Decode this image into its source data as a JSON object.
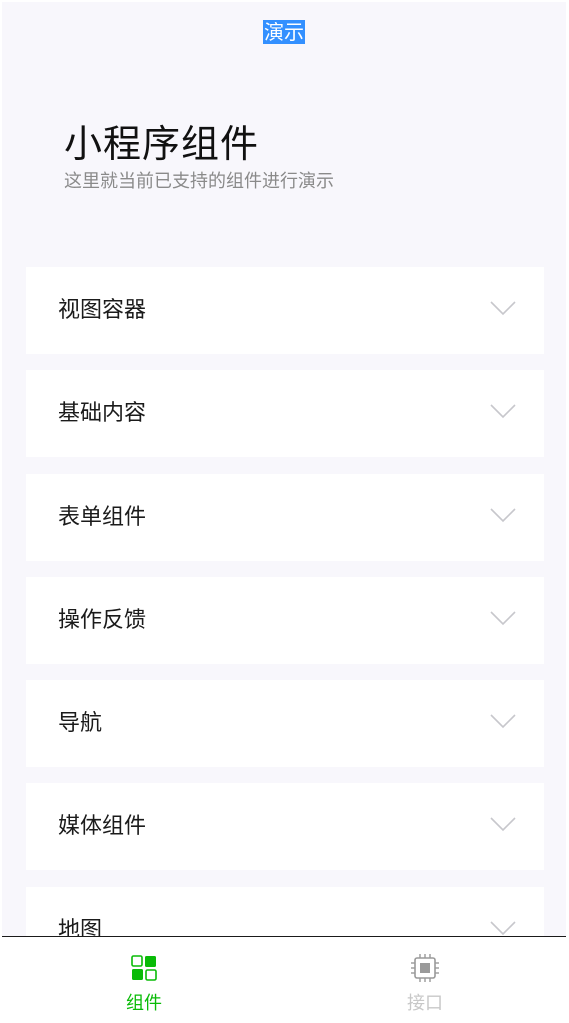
{
  "navbar": {
    "title": "演示"
  },
  "header": {
    "title": "小程序组件",
    "desc": "这里就当前已支持的组件进行演示"
  },
  "kinds": [
    {
      "label": "视图容器"
    },
    {
      "label": "基础内容"
    },
    {
      "label": "表单组件"
    },
    {
      "label": "操作反馈"
    },
    {
      "label": "导航"
    },
    {
      "label": "媒体组件"
    },
    {
      "label": "地图"
    }
  ],
  "tabbar": {
    "items": [
      {
        "label": "组件",
        "icon": "components-icon",
        "active": true
      },
      {
        "label": "接口",
        "icon": "chip-icon",
        "active": false
      }
    ]
  },
  "colors": {
    "accent": "#09bb07",
    "inactive": "#c8c8c8",
    "selection": "#3390ff",
    "chevron": "#c7c7cc"
  }
}
